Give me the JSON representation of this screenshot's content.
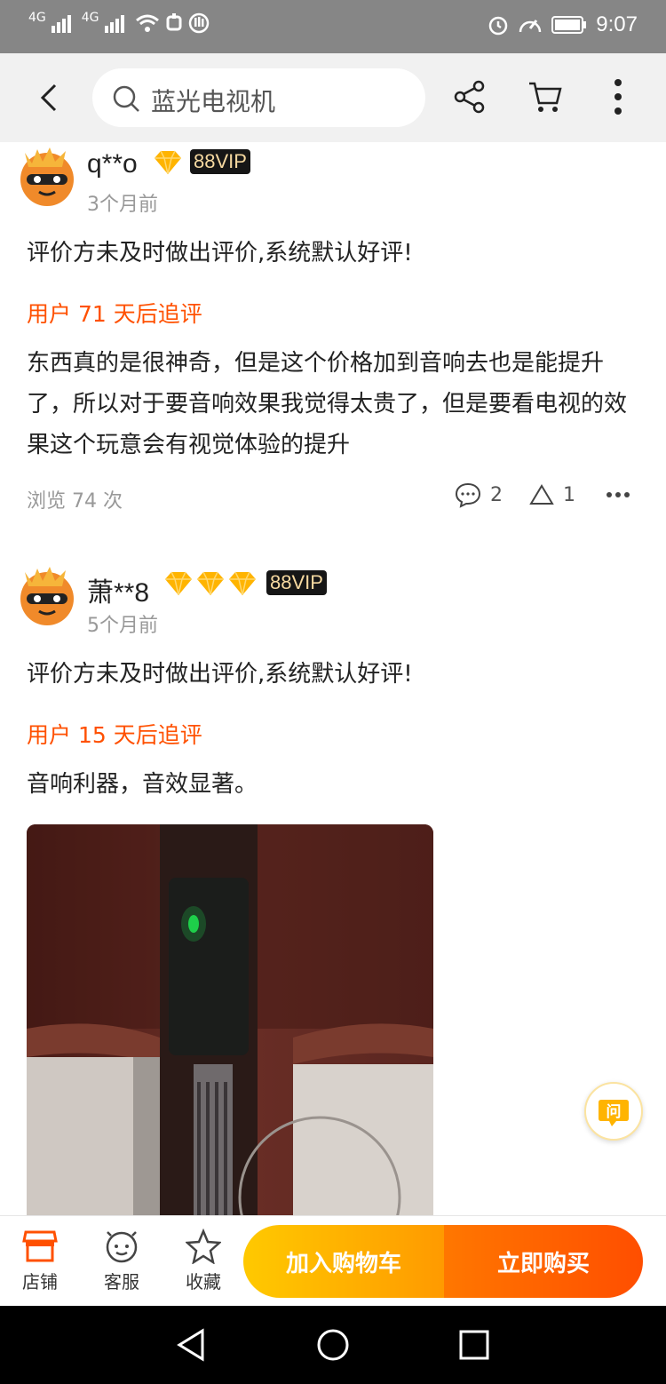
{
  "status_bar": {
    "time": "9:07",
    "signal1": "4G",
    "signal2": "4G"
  },
  "search": {
    "query": "蓝光电视机"
  },
  "reviews": [
    {
      "username": "q**o",
      "vip_label": "88VIP",
      "diamonds": 1,
      "time": "3个月前",
      "content": "评价方未及时做出评价,系统默认好评!",
      "followup_label": "用户 71 天后追评",
      "followup_content": "东西真的是很神奇，但是这个价格加到音响去也是能提升了，所以对于要音响效果我觉得太贵了，但是要看电视的效果这个玩意会有视觉体验的提升",
      "views": "浏览 74 次",
      "comments": "2",
      "likes": "1"
    },
    {
      "username": "萧**8",
      "vip_label": "88VIP",
      "diamonds": 3,
      "time": "5个月前",
      "content": "评价方未及时做出评价,系统默认好评!",
      "followup_label": "用户 15 天后追评",
      "followup_content": "音响利器，音效显著。"
    }
  ],
  "ask_button": {
    "label": "问"
  },
  "bottom_bar": {
    "store": "店铺",
    "service": "客服",
    "favorite": "收藏",
    "add_to_cart": "加入购物车",
    "buy_now": "立即购买"
  },
  "colors": {
    "accent": "#ff5000",
    "cart_btn": "#ffb400",
    "buy_btn": "#ff5a00"
  }
}
